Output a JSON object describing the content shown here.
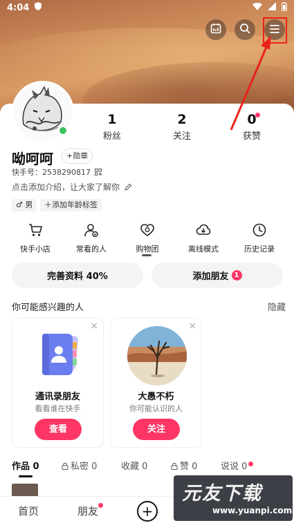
{
  "status_bar": {
    "time": "4:04"
  },
  "colors": {
    "accent": "#fe3666",
    "highlight": "#e8221b",
    "online": "#3bc25c"
  },
  "header": {
    "buttons": [
      {
        "name": "calendar-icon"
      },
      {
        "name": "search-icon"
      },
      {
        "name": "menu-icon"
      }
    ]
  },
  "profile": {
    "stats": [
      {
        "value": "1",
        "label": "粉丝"
      },
      {
        "value": "2",
        "label": "关注"
      },
      {
        "value": "0",
        "label": "获赞"
      }
    ],
    "name": "呦呵呵",
    "badge_label": "+勋章",
    "kuaishou_id": "快手号：2538290817",
    "intro": "点击添加介绍，让大家了解你",
    "tags": [
      "♂ 男",
      "＋添加年龄标签"
    ]
  },
  "quick_links": [
    {
      "label": "快手小店",
      "icon": "cart-icon"
    },
    {
      "label": "常看的人",
      "icon": "user-check-icon"
    },
    {
      "label": "购物团",
      "icon": "heart-group-icon"
    },
    {
      "label": "离线模式",
      "icon": "download-cloud-icon"
    },
    {
      "label": "历史记录",
      "icon": "clock-icon"
    }
  ],
  "actions": {
    "complete_profile": "完善资料 40%",
    "add_friend": "添加朋友",
    "add_friend_count": "1"
  },
  "recommend": {
    "title": "你可能感兴趣的人",
    "hide": "隐藏",
    "cards": [
      {
        "title": "通讯录朋友",
        "subtitle": "看看谁在快手",
        "button": "查看"
      },
      {
        "title": "大愚不朽",
        "subtitle": "你可能认识的人",
        "button": "关注"
      }
    ]
  },
  "tabs": [
    {
      "label": "作品 0"
    },
    {
      "label": "私密 0"
    },
    {
      "label": "收藏 0"
    },
    {
      "label": "赞 0"
    },
    {
      "label": "说说 0"
    }
  ],
  "bottom_nav": {
    "home": "首页",
    "friends": "朋友",
    "plus": "+"
  },
  "watermark": {
    "logo": "元友下载",
    "url": "www.yuanpi.com"
  }
}
